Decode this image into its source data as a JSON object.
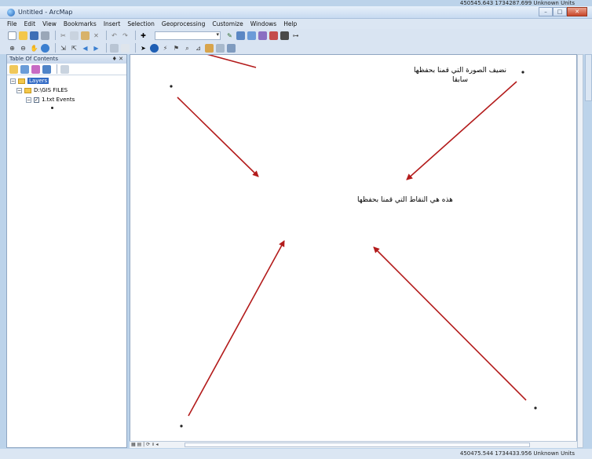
{
  "top_coordinates": "450545.643 1734287.699 Unknown Units",
  "window": {
    "title": "Untitled - ArcMap",
    "minimize": "–",
    "maximize": "□",
    "close": "✕"
  },
  "menu": [
    "File",
    "Edit",
    "View",
    "Bookmarks",
    "Insert",
    "Selection",
    "Geoprocessing",
    "Customize",
    "Windows",
    "Help"
  ],
  "toc": {
    "title": "Table Of Contents",
    "pin": "♦ ✕",
    "layers_label": "Layers",
    "folder_label": "D:\\GIS FILES",
    "layer_label": "1.txt Events",
    "expand_symbol": "−",
    "check_symbol": "✓"
  },
  "annotations": {
    "top_line1": "نضيف الصورة التي قمنا بحفظها",
    "top_line2": "سابقا",
    "middle": "هذه هي النقاط التي قمنا بحفظها"
  },
  "statusbar": {
    "coordinates": "450475.544 1734433.956 Unknown Units"
  },
  "colors": {
    "arrow": "#b31b1b",
    "titlebar_close": "#c8462a",
    "selection": "#316ac5"
  }
}
